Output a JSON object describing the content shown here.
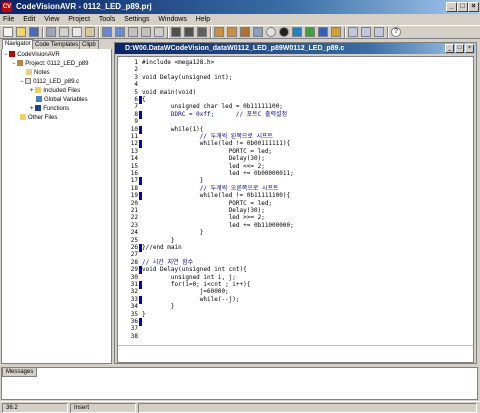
{
  "window": {
    "title": "CodeVisionAVR - 0112_LED_p89.prj",
    "app_icon": "CV",
    "min": "_",
    "max": "□",
    "close": "×"
  },
  "menu": [
    "File",
    "Edit",
    "View",
    "Project",
    "Tools",
    "Settings",
    "Windows",
    "Help"
  ],
  "left_tabs": [
    "Navigator",
    "Code Templates",
    "Clipb"
  ],
  "tree": [
    {
      "label": "CodeVisionAVR",
      "icon": "app-icon",
      "expander": "−"
    },
    {
      "label": "Project: 0112_LED_p89",
      "icon": "project-icon",
      "expander": "−"
    },
    {
      "label": "Notes",
      "icon": "notes-icon",
      "expander": ""
    },
    {
      "label": "0112_LED_p89.c",
      "icon": "c-file-icon",
      "expander": "−"
    },
    {
      "label": "Included Files",
      "icon": "folder-icon",
      "expander": "+"
    },
    {
      "label": "Global Variables",
      "icon": "variables-icon",
      "expander": ""
    },
    {
      "label": "Functions",
      "icon": "functions-icon",
      "expander": "+"
    },
    {
      "label": "Other Files",
      "icon": "folder-icon",
      "expander": ""
    }
  ],
  "editor": {
    "title": "D:W00.DataWCodeVision_dataW0112_LED_p89W0112_LED_p89.c",
    "min": "_",
    "max": "□",
    "close": "×",
    "lines": [
      "#include <mega128.h>",
      "",
      "void Delay(unsigned int);",
      "",
      "void main(void)",
      "{",
      "        unsigned char led = 0b11111100;",
      "        DDRC = 0xff;      // 포트C 출력설정",
      "",
      "        while(1){",
      "                // 두개씩 왼쪽으로 시프트",
      "                while(led != 0b00111111){",
      "                        PORTC = led;",
      "                        Delay(30);",
      "                        led <<= 2;",
      "                        led += 0b00000011;",
      "                }",
      "                // 두개씩 오른쪽으로 시프트",
      "                while(led != 0b11111100){",
      "                        PORTC = led;",
      "                        Delay(30);",
      "                        led >>= 2;",
      "                        led += 0b11000000;",
      "                }",
      "        }",
      "}//end main",
      "",
      "// 시간 지연 함수",
      "void Delay(unsigned int cnt){",
      "        unsigned int i, j;",
      "        for(i=0; i<cnt ; i++){",
      "                j=60000;",
      "                while(--j);",
      "        }",
      "}",
      "",
      "",
      ""
    ]
  },
  "messages_tab": "Messages",
  "status": {
    "position": "36:2",
    "mode": "Insert",
    "extra": ""
  }
}
